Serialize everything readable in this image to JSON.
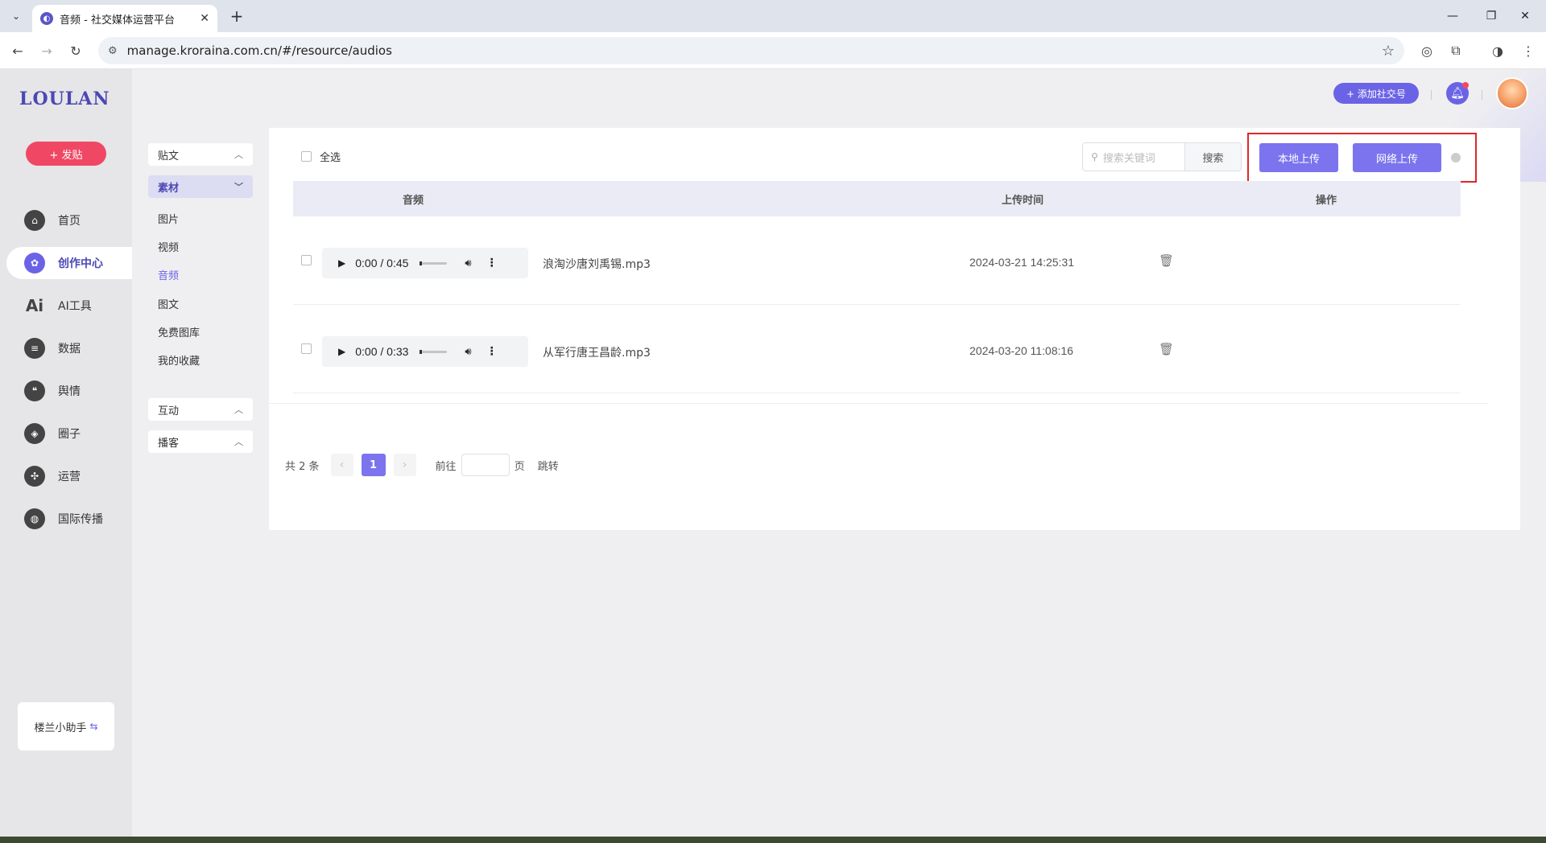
{
  "browser": {
    "tab_title": "音频 - 社交媒体运营平台",
    "url": "manage.kroraina.com.cn/#/resource/audios"
  },
  "app": {
    "logo": "LOULAN",
    "post_button": "+ 发贴",
    "nav": [
      {
        "label": "首页",
        "icon": "home-icon"
      },
      {
        "label": "创作中心",
        "icon": "palette-icon"
      },
      {
        "label": "AI工具",
        "icon": "ai-icon"
      },
      {
        "label": "数据",
        "icon": "database-icon"
      },
      {
        "label": "舆情",
        "icon": "quote-icon"
      },
      {
        "label": "圈子",
        "icon": "compass-icon"
      },
      {
        "label": "运营",
        "icon": "operation-icon"
      },
      {
        "label": "国际传播",
        "icon": "globe-icon"
      }
    ],
    "active_nav": "创作中心",
    "assistant_label": "楼兰小助手",
    "add_social_button": "+ 添加社交号"
  },
  "submenu": {
    "groups": [
      {
        "label": "贴文"
      },
      {
        "label": "素材",
        "items": [
          "图片",
          "视频",
          "音频",
          "图文",
          "免费图库",
          "我的收藏"
        ]
      },
      {
        "label": "互动"
      },
      {
        "label": "播客"
      }
    ],
    "active_item": "音频"
  },
  "content": {
    "select_all": "全选",
    "search_placeholder": "搜索关键词",
    "search_button": "搜索",
    "local_upload": "本地上传",
    "network_upload": "网络上传",
    "columns": [
      "音频",
      "上传时间",
      "操作"
    ],
    "rows": [
      {
        "time": "0:00 / 0:45",
        "filename": "浪淘沙唐刘禹锡.mp3",
        "uploaded": "2024-03-21 14:25:31"
      },
      {
        "time": "0:00 / 0:33",
        "filename": "从军行唐王昌龄.mp3",
        "uploaded": "2024-03-20 11:08:16"
      }
    ],
    "pagination": {
      "total": "共 2 条",
      "current_page": "1",
      "goto_prefix": "前往",
      "goto_suffix": "页",
      "jump": "跳转"
    }
  },
  "colors": {
    "accent": "#6b63e6",
    "post": "#f04864",
    "highlight_frame": "#e0262a"
  }
}
